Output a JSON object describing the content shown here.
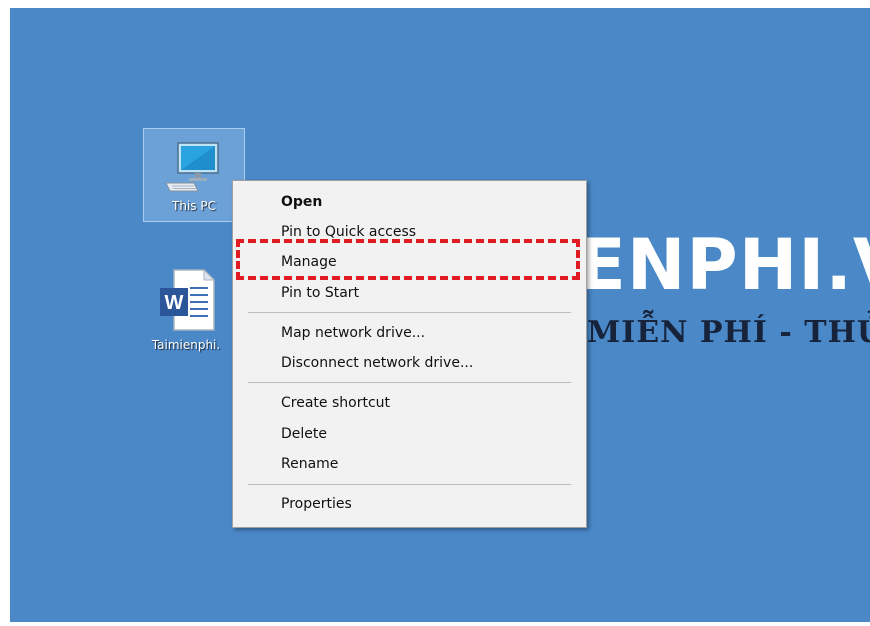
{
  "desktop": {
    "background_color": "#4a88c8",
    "watermark_title": "ENPHI.V",
    "watermark_subtitle": "MIỄN PHÍ - THỦ",
    "icons": [
      {
        "label": "This PC",
        "icon": "this-pc-icon",
        "selected": true
      },
      {
        "label": "Taimienphi.",
        "icon": "word-document-icon",
        "selected": false
      }
    ]
  },
  "context_menu": {
    "items": [
      {
        "label": "Open",
        "bold": true
      },
      {
        "label": "Pin to Quick access"
      },
      {
        "label": "Manage",
        "highlighted": true
      },
      {
        "label": "Pin to Start"
      },
      {
        "label": "Map network drive..."
      },
      {
        "label": "Disconnect network drive..."
      },
      {
        "label": "Create shortcut"
      },
      {
        "label": "Delete"
      },
      {
        "label": "Rename"
      },
      {
        "label": "Properties"
      }
    ],
    "highlight_color": "#e11b22"
  }
}
